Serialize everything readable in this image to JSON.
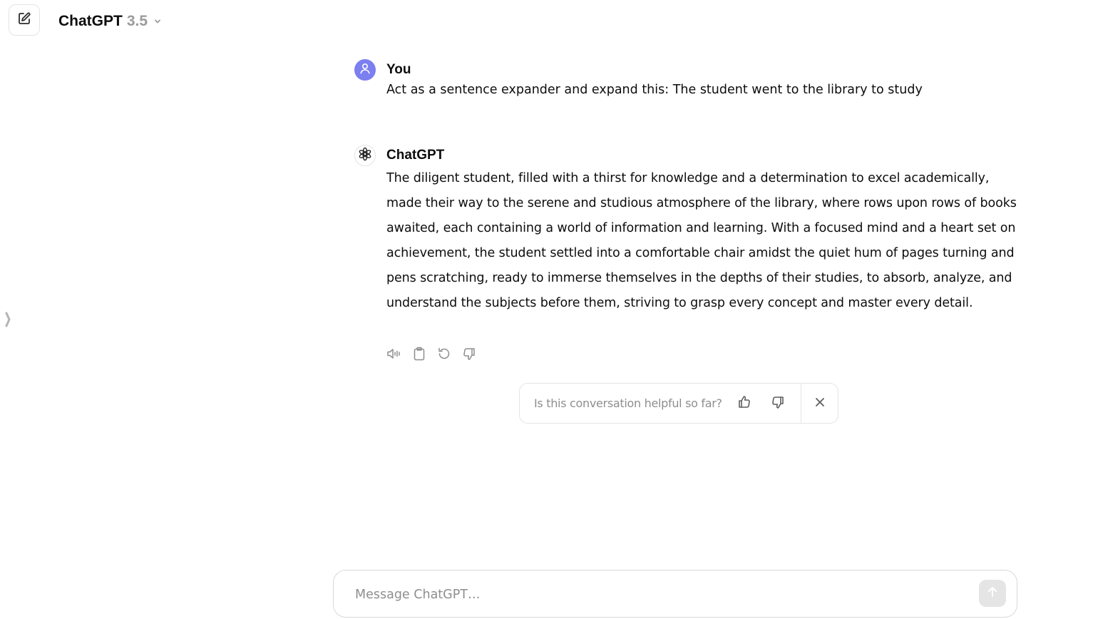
{
  "header": {
    "model_name": "ChatGPT",
    "model_version": "3.5"
  },
  "icons": {
    "new_chat": "edit-icon",
    "model_dropdown": "chevron-down-icon",
    "sidebar_toggle": "chevron-right-icon",
    "user_avatar": "user-icon",
    "bot_avatar": "openai-logo-icon",
    "read_aloud": "speaker-icon",
    "copy": "clipboard-icon",
    "regenerate": "refresh-icon",
    "bad_response": "thumbs-down-icon",
    "send": "arrow-up-icon",
    "close": "close-icon"
  },
  "conversation": {
    "messages": [
      {
        "author": "You",
        "text": "Act as a sentence expander and expand this: The student went to the library to study"
      },
      {
        "author": "ChatGPT",
        "text": "The diligent student, filled with a thirst for knowledge and a determination to excel academically, made their way to the serene and studious atmosphere of the library, where rows upon rows of books awaited, each containing a world of information and learning. With a focused mind and a heart set on achievement, the student settled into a comfortable chair amidst the quiet hum of pages turning and pens scratching, ready to immerse themselves in the depths of their studies, to absorb, analyze, and understand the subjects before them, striving to grasp every concept and master every detail."
      }
    ]
  },
  "feedback": {
    "question": "Is this conversation helpful so far?"
  },
  "composer": {
    "placeholder": "Message ChatGPT…",
    "value": ""
  },
  "colors": {
    "user_avatar_bg": "#7b7ff0",
    "muted_text": "#8e8e8e",
    "border": "#e3e3e3"
  }
}
